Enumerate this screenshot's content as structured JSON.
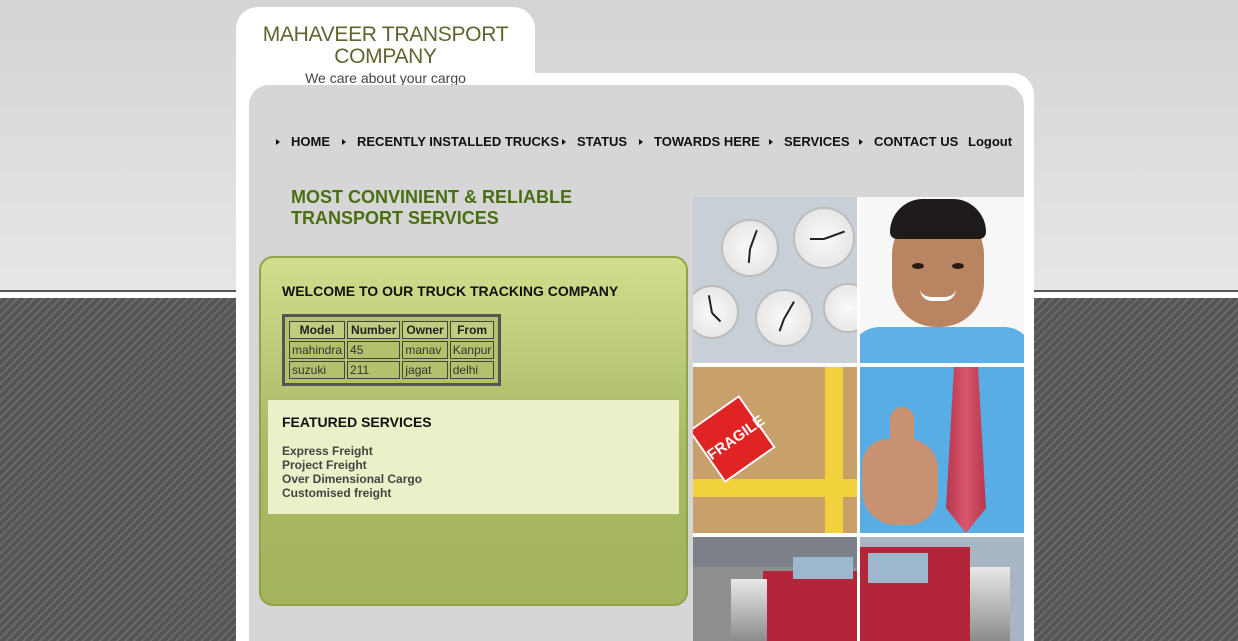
{
  "brand": {
    "title": "MAHAVEER TRANSPORT COMPANY",
    "tagline": "We care about your cargo"
  },
  "nav": {
    "items": [
      {
        "label": "HOME",
        "bullet": true
      },
      {
        "label": "RECENTLY INSTALLED TRUCKS",
        "bullet": true
      },
      {
        "label": "STATUS",
        "bullet": true
      },
      {
        "label": "TOWARDS HERE",
        "bullet": true
      },
      {
        "label": "SERVICES",
        "bullet": true
      },
      {
        "label": "CONTACT US",
        "bullet": true
      },
      {
        "label": "Logout",
        "bullet": false
      }
    ]
  },
  "headline": "MOST CONVINIENT & RELIABLE TRANSPORT SERVICES",
  "welcome": {
    "title": "WELCOME TO OUR TRUCK TRACKING COMPANY",
    "table": {
      "headers": [
        "Model",
        "Number",
        "Owner",
        "From"
      ],
      "rows": [
        [
          "mahindra",
          "45",
          "manav",
          "Kanpur"
        ],
        [
          "suzuki",
          "211",
          "jagat",
          "delhi"
        ]
      ]
    }
  },
  "featured": {
    "title": "FEATURED SERVICES",
    "items": [
      "Express Freight",
      "Project Freight",
      "Over Dimensional Cargo",
      "Customised freight"
    ]
  },
  "mosaic": {
    "fragile_text": "FRAGILE",
    "tiles": [
      "clocks-image",
      "smiling-man-image",
      "fragile-box-image",
      "thumbs-up-man-image",
      "red-truck-image-left",
      "red-truck-image-right"
    ]
  },
  "colors": {
    "headline": "#4a6e12",
    "brand": "#636330",
    "panel": "#b4c472",
    "featured_bg": "#ecf0c8"
  }
}
